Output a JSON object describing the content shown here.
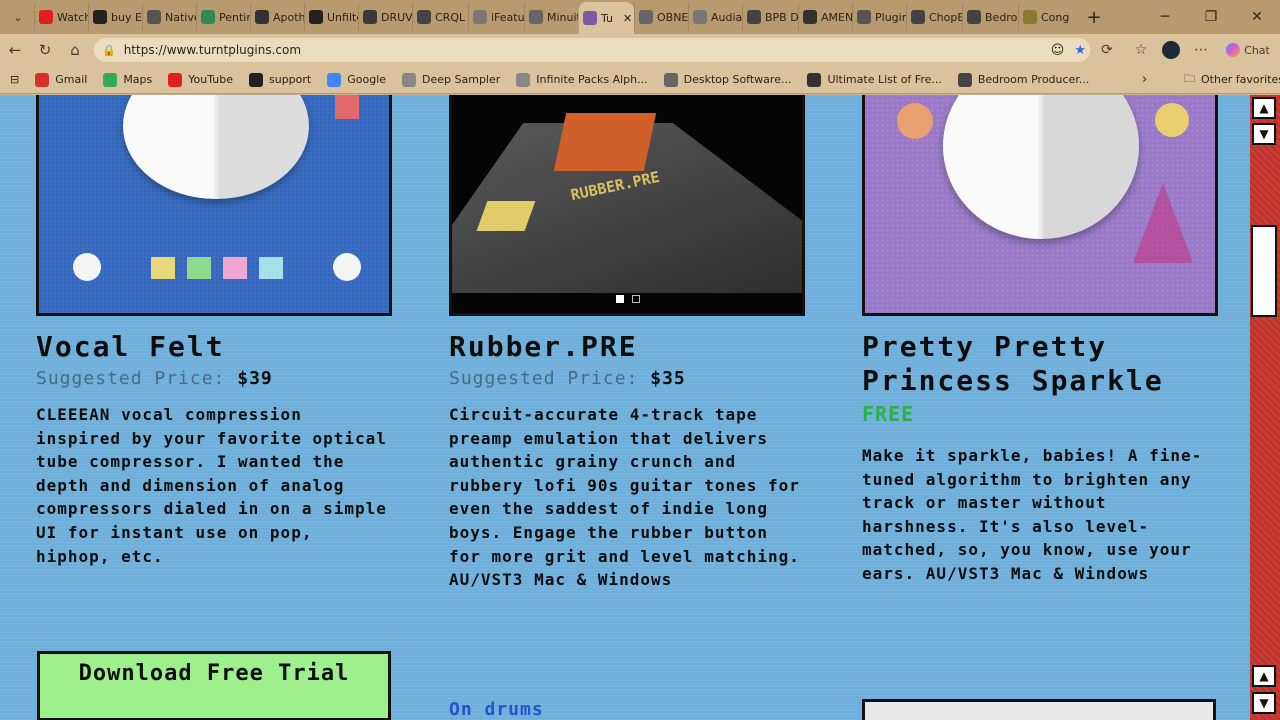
{
  "browser": {
    "tabs": [
      {
        "label": "Watch",
        "color": "#e02020"
      },
      {
        "label": "buy El",
        "color": "#222222"
      },
      {
        "label": "Native",
        "color": "#555555"
      },
      {
        "label": "Pentin",
        "color": "#2e8b57"
      },
      {
        "label": "Apoth",
        "color": "#333333"
      },
      {
        "label": "Unfilte",
        "color": "#222222"
      },
      {
        "label": "DRUV",
        "color": "#3a3a3a"
      },
      {
        "label": "CRQL",
        "color": "#444444"
      },
      {
        "label": "iFeatu",
        "color": "#777777"
      },
      {
        "label": "Minuit",
        "color": "#666666"
      },
      {
        "label": "Tu",
        "color": "#7a5aa0"
      },
      {
        "label": "OBNE",
        "color": "#666666"
      },
      {
        "label": "Audia",
        "color": "#777777"
      },
      {
        "label": "BPB D",
        "color": "#444444"
      },
      {
        "label": "AMEN",
        "color": "#333333"
      },
      {
        "label": "Plugin",
        "color": "#555555"
      },
      {
        "label": "ChopE",
        "color": "#444444"
      },
      {
        "label": "Bedro",
        "color": "#444444"
      },
      {
        "label": "Cong",
        "color": "#8a7a30"
      }
    ],
    "active_tab_index": 10,
    "url": "https://www.turntplugins.com",
    "chat_label": "Chat",
    "bookmarks": [
      {
        "label": "Gmail",
        "color": "#d93025"
      },
      {
        "label": "Maps",
        "color": "#34a853"
      },
      {
        "label": "YouTube",
        "color": "#e02020"
      },
      {
        "label": "support",
        "color": "#222222"
      },
      {
        "label": "Google",
        "color": "#4285f4"
      },
      {
        "label": "Deep Sampler",
        "color": "#888888"
      },
      {
        "label": "Infinite Packs Alph...",
        "color": "#888888"
      },
      {
        "label": "Desktop Software...",
        "color": "#666666"
      },
      {
        "label": "Ultimate List of Fre...",
        "color": "#333333"
      },
      {
        "label": "Bedroom Producer...",
        "color": "#444444"
      }
    ],
    "other_favorites": "Other favorites"
  },
  "products": [
    {
      "title": "Vocal Felt",
      "price_label": "Suggested Price:",
      "price": "$39",
      "description": "CLEEEAN vocal compression inspired by your favorite optical tube compressor. I wanted the depth and dimension of analog compressors dialed in on a simple UI for instant use on pop, hiphop, etc.",
      "button": "Download Free Trial"
    },
    {
      "title": "Rubber.PRE",
      "price_label": "Suggested Price:",
      "price": "$35",
      "description": "Circuit-accurate 4-track tape preamp emulation that delivers authentic grainy crunch and rubbery lofi 90s guitar tones for even the saddest of indie long boys. Engage the rubber button for more grit and level matching. AU/VST3 Mac & Windows",
      "link": "On drums",
      "image_text": "RUBBER.PRE"
    },
    {
      "title": "Pretty Pretty Princess Sparkle",
      "price": "FREE",
      "description": "Make it sparkle, babies! A fine-tuned algorithm to brighten any track or master without harshness. It's also level-matched, so, you know, use your ears. AU/VST3 Mac & Windows"
    }
  ],
  "colors": {
    "page_bg": "#6fb0db",
    "button_green": "#9ef08c",
    "free_green": "#2bb04a",
    "scrollbar_red": "#cc3b33"
  }
}
